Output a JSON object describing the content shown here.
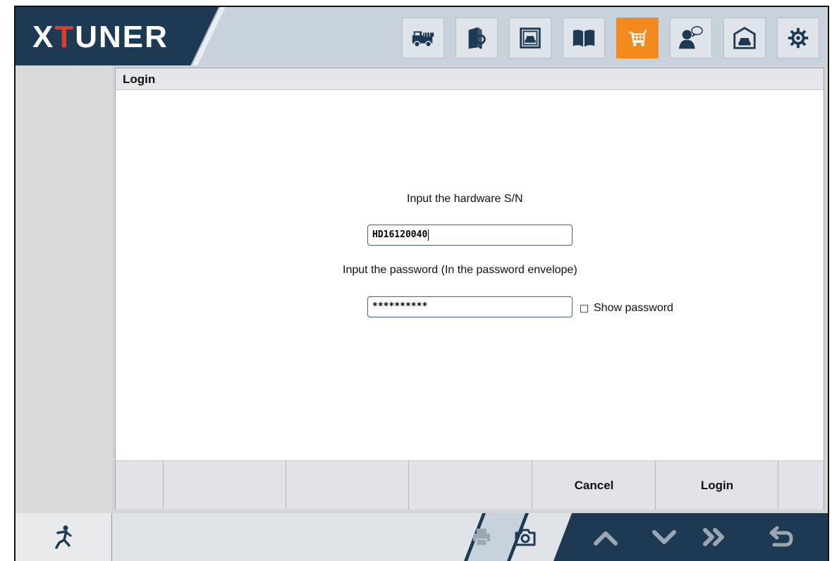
{
  "app": {
    "logo": {
      "prefix": "X",
      "highlight": "T",
      "suffix": "UNER"
    }
  },
  "toolbar": {
    "buttons": [
      {
        "name": "truck-icon",
        "active": false
      },
      {
        "name": "book-search-icon",
        "active": false
      },
      {
        "name": "car-window-icon",
        "active": false
      },
      {
        "name": "open-book-icon",
        "active": false
      },
      {
        "name": "shopping-cart-icon",
        "active": true
      },
      {
        "name": "user-chat-icon",
        "active": false
      },
      {
        "name": "garage-car-icon",
        "active": false
      },
      {
        "name": "gear-icon",
        "active": false
      }
    ],
    "active_color": "#f38a1e"
  },
  "panel": {
    "title": "Login"
  },
  "form": {
    "sn_label": "Input the hardware S/N",
    "sn_value": "HD16120040",
    "password_label": "Input the password (In the password envelope)",
    "password_value": "**********",
    "show_password_label": "Show password",
    "show_password_checked": false
  },
  "buttons": {
    "cancel": "Cancel",
    "login": "Login"
  },
  "footer": {
    "icons": [
      "exit-icon",
      "print-icon",
      "camera-icon",
      "up-arrow-icon",
      "down-arrow-icon",
      "forward-icon",
      "back-icon"
    ]
  },
  "colors": {
    "header_bg": "#1e3a52",
    "accent": "#f38a1e",
    "logo_red": "#e03a2b"
  }
}
